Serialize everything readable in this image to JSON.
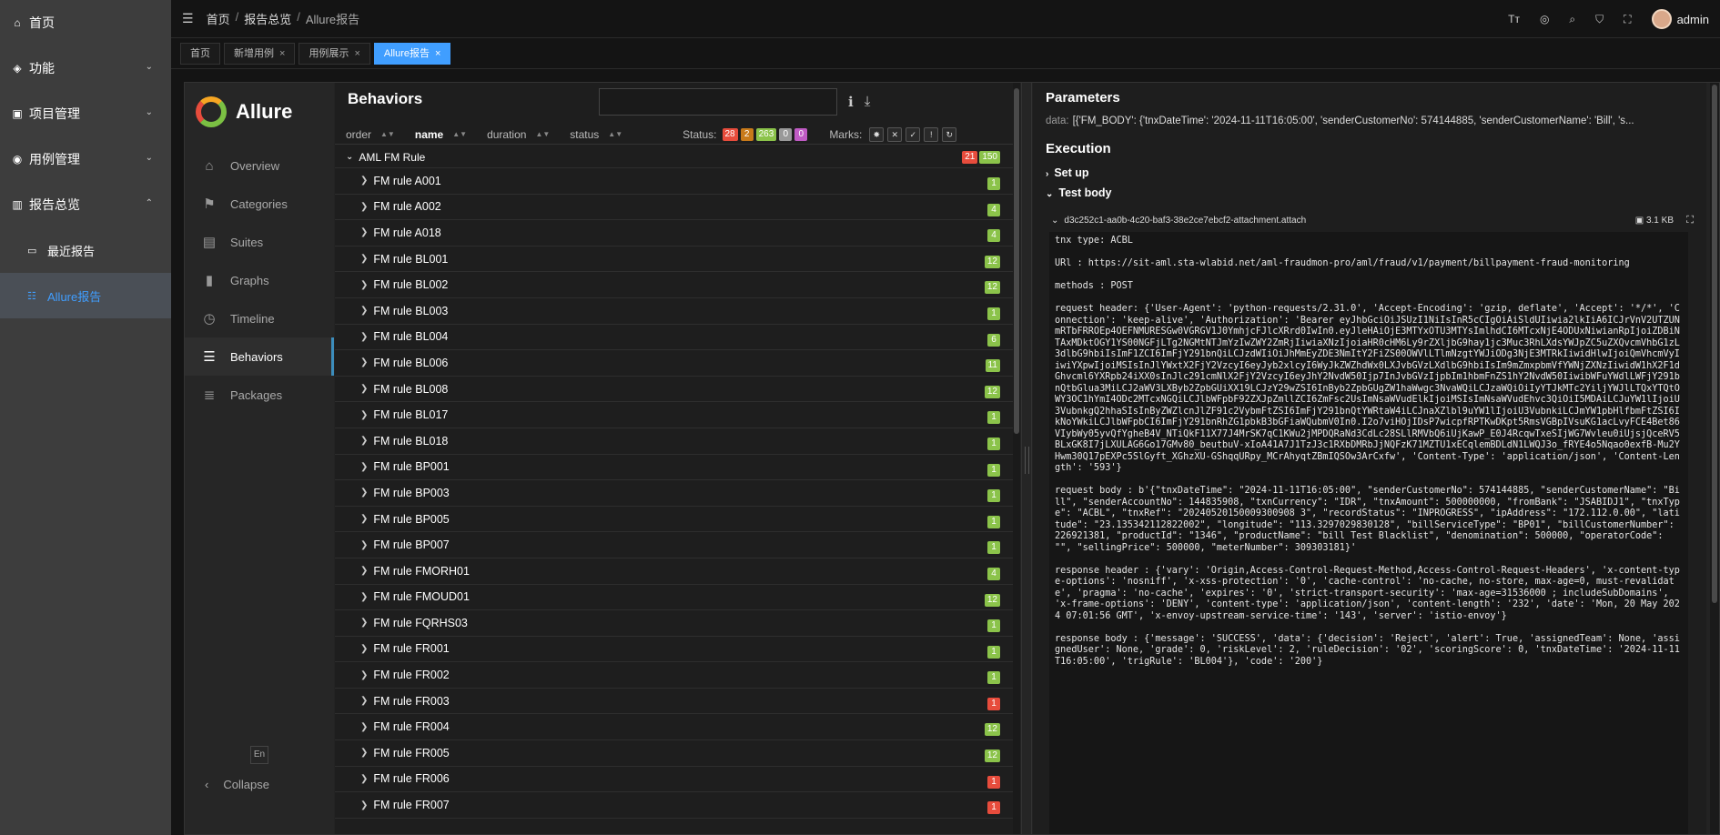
{
  "app_sidebar": {
    "items": [
      {
        "icon": "home-icon",
        "label": "首页",
        "chev": ""
      },
      {
        "icon": "cube-icon",
        "label": "功能",
        "chev": "⌄"
      },
      {
        "icon": "project-icon",
        "label": "项目管理",
        "chev": "⌄"
      },
      {
        "icon": "case-icon",
        "label": "用例管理",
        "chev": "⌄"
      },
      {
        "icon": "report-icon",
        "label": "报告总览",
        "chev": "⌃"
      }
    ],
    "subitems": [
      {
        "label": "最近报告"
      },
      {
        "label": "Allure报告"
      }
    ]
  },
  "topbar": {
    "breadcrumb": [
      "首页",
      "报告总览",
      "Allure报告"
    ],
    "username": "admin"
  },
  "tabs": [
    {
      "label": "首页"
    },
    {
      "label": "新增用例"
    },
    {
      "label": "用例展示"
    },
    {
      "label": "Allure报告"
    }
  ],
  "allure": {
    "logo": "Allure",
    "nav": [
      {
        "icon": "home-icon",
        "label": "Overview"
      },
      {
        "icon": "flag-icon",
        "label": "Categories"
      },
      {
        "icon": "briefcase-icon",
        "label": "Suites"
      },
      {
        "icon": "bar-chart-icon",
        "label": "Graphs"
      },
      {
        "icon": "clock-icon",
        "label": "Timeline"
      },
      {
        "icon": "list-icon",
        "label": "Behaviors"
      },
      {
        "icon": "stack-icon",
        "label": "Packages"
      }
    ],
    "lang": "En",
    "collapse": "Collapse"
  },
  "behaviors": {
    "title": "Behaviors",
    "columns": {
      "order": "order",
      "name": "name",
      "duration": "duration",
      "status": "status"
    },
    "status_label": "Status:",
    "status_counts": [
      "28",
      "2",
      "263",
      "0",
      "0"
    ],
    "marks_label": "Marks:",
    "group": {
      "name": "AML FM Rule",
      "failed": "21",
      "passed": "150"
    },
    "rules": [
      {
        "name": "FM rule A001",
        "count": "1",
        "color": "green"
      },
      {
        "name": "FM rule A002",
        "count": "4",
        "color": "green"
      },
      {
        "name": "FM rule A018",
        "count": "4",
        "color": "green"
      },
      {
        "name": "FM rule BL001",
        "count": "12",
        "color": "green"
      },
      {
        "name": "FM rule BL002",
        "count": "12",
        "color": "green"
      },
      {
        "name": "FM rule BL003",
        "count": "1",
        "color": "green"
      },
      {
        "name": "FM rule BL004",
        "count": "6",
        "color": "green"
      },
      {
        "name": "FM rule BL006",
        "count": "11",
        "color": "green"
      },
      {
        "name": "FM rule BL008",
        "count": "12",
        "color": "green"
      },
      {
        "name": "FM rule BL017",
        "count": "1",
        "color": "green"
      },
      {
        "name": "FM rule BL018",
        "count": "1",
        "color": "green"
      },
      {
        "name": "FM rule BP001",
        "count": "1",
        "color": "green"
      },
      {
        "name": "FM rule BP003",
        "count": "1",
        "color": "green"
      },
      {
        "name": "FM rule BP005",
        "count": "1",
        "color": "green"
      },
      {
        "name": "FM rule BP007",
        "count": "1",
        "color": "green"
      },
      {
        "name": "FM rule FMORH01",
        "count": "4",
        "color": "green"
      },
      {
        "name": "FM rule FMOUD01",
        "count": "12",
        "color": "green"
      },
      {
        "name": "FM rule FQRHS03",
        "count": "1",
        "color": "green"
      },
      {
        "name": "FM rule FR001",
        "count": "1",
        "color": "green"
      },
      {
        "name": "FM rule FR002",
        "count": "1",
        "color": "green"
      },
      {
        "name": "FM rule FR003",
        "count": "1",
        "color": "red"
      },
      {
        "name": "FM rule FR004",
        "count": "12",
        "color": "green"
      },
      {
        "name": "FM rule FR005",
        "count": "12",
        "color": "green"
      },
      {
        "name": "FM rule FR006",
        "count": "1",
        "color": "red"
      },
      {
        "name": "FM rule FR007",
        "count": "1",
        "color": "red"
      }
    ]
  },
  "detail": {
    "parameters_title": "Parameters",
    "data_key": "data:",
    "data_value": "[{'FM_BODY': {'tnxDateTime': '2024-11-11T16:05:00', 'senderCustomerNo': 574144885, 'senderCustomerName': 'Bill', 's...",
    "execution_title": "Execution",
    "setup": "Set up",
    "testbody": "Test body",
    "attachment": "d3c252c1-aa0b-4c20-baf3-38e2ce7ebcf2-attachment.attach",
    "attachment_size": "3.1 KB",
    "log": "tnx type: ACBL\n\nURl : https://sit-aml.sta-wlabid.net/aml-fraudmon-pro/aml/fraud/v1/payment/billpayment-fraud-monitoring\n\nmethods : POST\n\nrequest header: {'User-Agent': 'python-requests/2.31.0', 'Accept-Encoding': 'gzip, deflate', 'Accept': '*/*', 'Connection': 'keep-alive', 'Authorization': 'Bearer eyJhbGciOiJSUzI1NiIsInR5cCIgOiAiSldUIiwia2lkIiA6ICJrVnV2UTZUNmRTbFRROEp4OEFNMURESGw0VGRGV1J0YmhjcFJlcXRrd0IwIn0.eyJleHAiOjE3MTYxOTU3MTYsImlhdCI6MTcxNjE4ODUxNiwianRpIjoiZDBiNTAxMDktOGY1YS00NGFjLTg2NGMtNTJmYzIwZWY2ZmRjIiwiaXNzIjoiaHR0cHM6Ly9rZXljbG9hay1jc3Muc3RhLXdsYWJpZC5uZXQvcmVhbG1zL3dlbG9hbiIsImF1ZCI6ImFjY291bnQiLCJzdWIiOiJhMmEyZDE3NmItY2FiZS00OWVlLTlmNzgtYWJiODg3NjE3MTRkIiwidHlwIjoiQmVhcmVyIiwiYXpwIjoiMSIsInJlYWxtX2FjY2VzcyI6eyJyb2xlcyI6WyJkZWZhdWx0LXJvbGVzLXdlbG9hbiIsIm9mZmxpbmVfYWNjZXNzIiwidW1hX2F1dGhvcml6YXRpb24iXX0sInJlc291cmNlX2FjY2VzcyI6eyJhY2NvdW50Ijp7InJvbGVzIjpbIm1hbmFnZS1hY2NvdW50IiwibWFuYWdlLWFjY291bnQtbGlua3MiLCJ2aWV3LXByb2ZpbGUiXX19LCJzY29wZSI6InByb2ZpbGUgZW1haWwgc3NvaWQiLCJzaWQiOiIyYTJkMTc2YiljYWJlLTQxYTQtOWY3OC1hYmI4ODc2MTcxNGQiLCJlbWFpbF92ZXJpZmllZCI6ZmFsc2UsImNsaWVudElkIjoiMSIsImNsaWVudEhvc3QiOiI5MDAiLCJuYW1lIjoiU3VubnkgQ2hhaSIsInByZWZlcnJlZF91c2VybmFtZSI6ImFjY291bnQtYWRtaW4iLCJnaXZlbl9uYW1lIjoiU3VubnkiLCJmYW1pbHlfbmFtZSI6IkNoYWkiLCJlbWFpbCI6ImFjY291bnRhZG1pbkB3bGFiaWQubmV0In0.I2o7viHOjIDsP7wicpfRPTKwDKpt5RmsVGBpIVsuKG1acLvyFCE4Bet86VIybWy05yvQfYgheB4V_NTiQkF11X77J4MrSK7qC1KWu2jMPDQRaNd3CdLc28SLlRMVbQ6iUjKawP_E0J4RcqwTxeSIjWG7Wvleu0iUjsjQceRV5BLxGK8I7jLXULAG6Go17GMv80_beutbuV-xIoA41A7J1TzJ3c1RXbDMRbJjNQFzK71MZTU1xECqlemBDLdN1LWQJ3o_fRYE4o5Nqao0exfB-Mu2YHwm30Q17pEXPc5SlGyft_XGhzXU-GShqqURpy_MCrAhyqtZBmIQSOw3ArCxfw', 'Content-Type': 'application/json', 'Content-Length': '593'}\n\nrequest body : b'{\"tnxDateTime\": \"2024-11-11T16:05:00\", \"senderCustomerNo\": 574144885, \"senderCustomerName\": \"Bill\", \"senderAccountNo\": 144835908, \"txnCurrency\": \"IDR\", \"tnxAmount\": 500000000, \"fromBank\": \"JSABIDJ1\", \"tnxType\": \"ACBL\", \"tnxRef\": \"20240520150009300908 3\", \"recordStatus\": \"INPROGRESS\", \"ipAddress\": \"172.112.0.00\", \"latitude\": \"23.135342112822002\", \"longitude\": \"113.3297029830128\", \"billServiceType\": \"BP01\", \"billCustomerNumber\": 226921381, \"productId\": \"1346\", \"productName\": \"bill Test Blacklist\", \"denomination\": 500000, \"operatorCode\": \"\", \"sellingPrice\": 500000, \"meterNumber\": 309303181}'\n\nresponse header : {'vary': 'Origin,Access-Control-Request-Method,Access-Control-Request-Headers', 'x-content-type-options': 'nosniff', 'x-xss-protection': '0', 'cache-control': 'no-cache, no-store, max-age=0, must-revalidate', 'pragma': 'no-cache', 'expires': '0', 'strict-transport-security': 'max-age=31536000 ; includeSubDomains', 'x-frame-options': 'DENY', 'content-type': 'application/json', 'content-length': '232', 'date': 'Mon, 20 May 2024 07:01:56 GMT', 'x-envoy-upstream-service-time': '143', 'server': 'istio-envoy'}\n\nresponse body : {'message': 'SUCCESS', 'data': {'decision': 'Reject', 'alert': True, 'assignedTeam': None, 'assignedUser': None, 'grade': 0, 'riskLevel': 2, 'ruleDecision': '02', 'scoringScore': 0, 'tnxDateTime': '2024-11-11T16:05:00', 'trigRule': 'BL004'}, 'code': '200'}"
  }
}
